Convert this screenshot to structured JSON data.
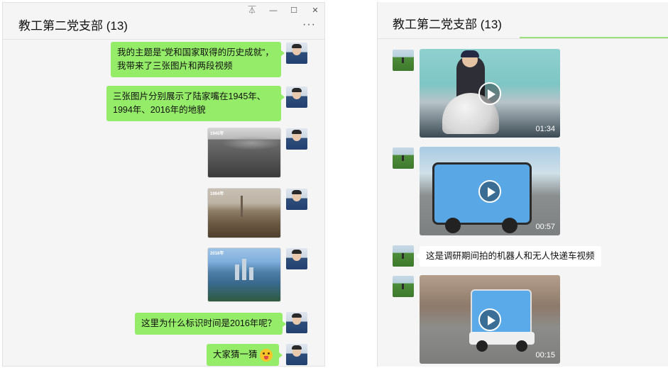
{
  "left_window": {
    "title": "教工第二党支部 (13)",
    "controls": {
      "pin": "⏄",
      "minimize": "—",
      "maximize": "☐",
      "close": "✕"
    },
    "more": "···",
    "messages": [
      {
        "type": "text",
        "text": "我的主题是“党和国家取得的历史成就”，我带来了三张图片和两段视频"
      },
      {
        "type": "text",
        "text": "三张图片分别展示了陆家嘴在1945年、1994年、2016年的地貌"
      },
      {
        "type": "image",
        "year": "1945年"
      },
      {
        "type": "image",
        "year": "1994年"
      },
      {
        "type": "image",
        "year": "2016年"
      },
      {
        "type": "text",
        "text": "这里为什么标识时间是2016年呢？"
      },
      {
        "type": "text",
        "text": "大家猜一猜"
      }
    ]
  },
  "right_window": {
    "title": "教工第二党支部 (13)",
    "messages": [
      {
        "type": "video",
        "duration": "01:34"
      },
      {
        "type": "video",
        "duration": "00:57"
      },
      {
        "type": "text",
        "text": "这是调研期间拍的机器人和无人快递车视频"
      },
      {
        "type": "video",
        "duration": "00:15"
      }
    ]
  },
  "colors": {
    "bubble_green": "#95ec69",
    "bubble_white": "#ffffff",
    "panel_bg": "#f5f5f5"
  }
}
